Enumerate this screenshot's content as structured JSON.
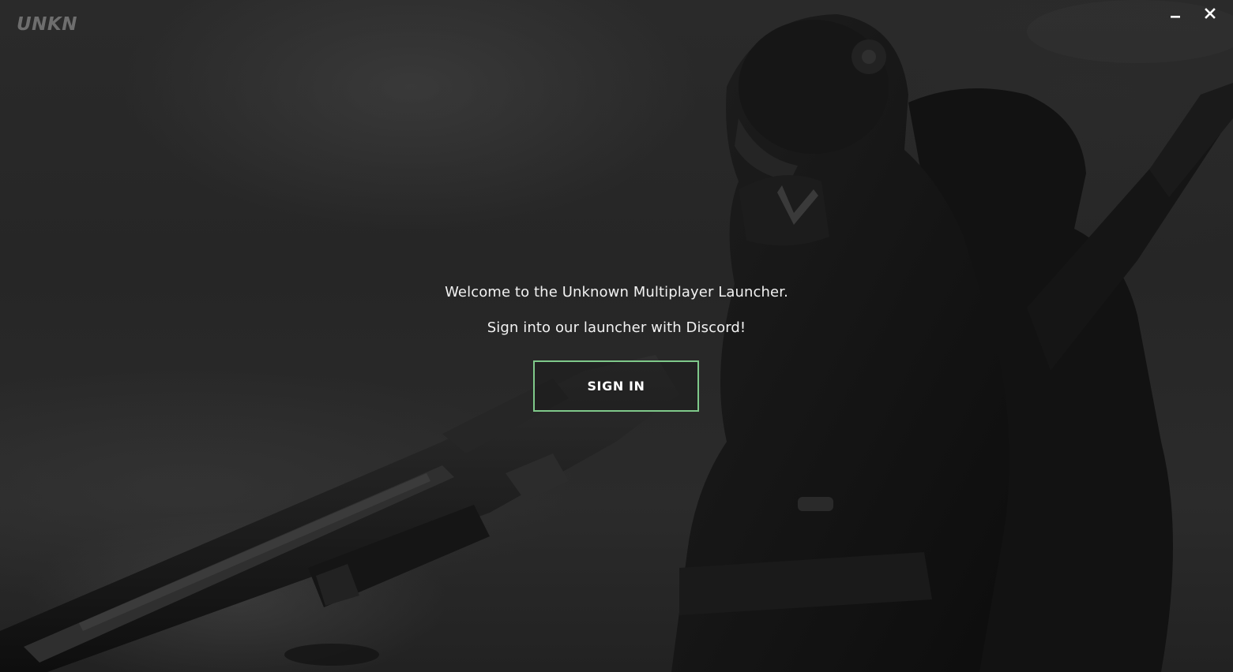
{
  "app": {
    "logo_text": "UNKN"
  },
  "titlebar": {
    "minimize_icon": "minimize-icon",
    "close_icon": "close-icon"
  },
  "main": {
    "welcome_text": "Welcome to the Unknown Multiplayer Launcher.",
    "sign_in_prompt": "Sign into our launcher with Discord!",
    "sign_in_label": "SIGN IN"
  },
  "colors": {
    "accent_border": "#7fc98a",
    "text": "#f2f2f2"
  }
}
